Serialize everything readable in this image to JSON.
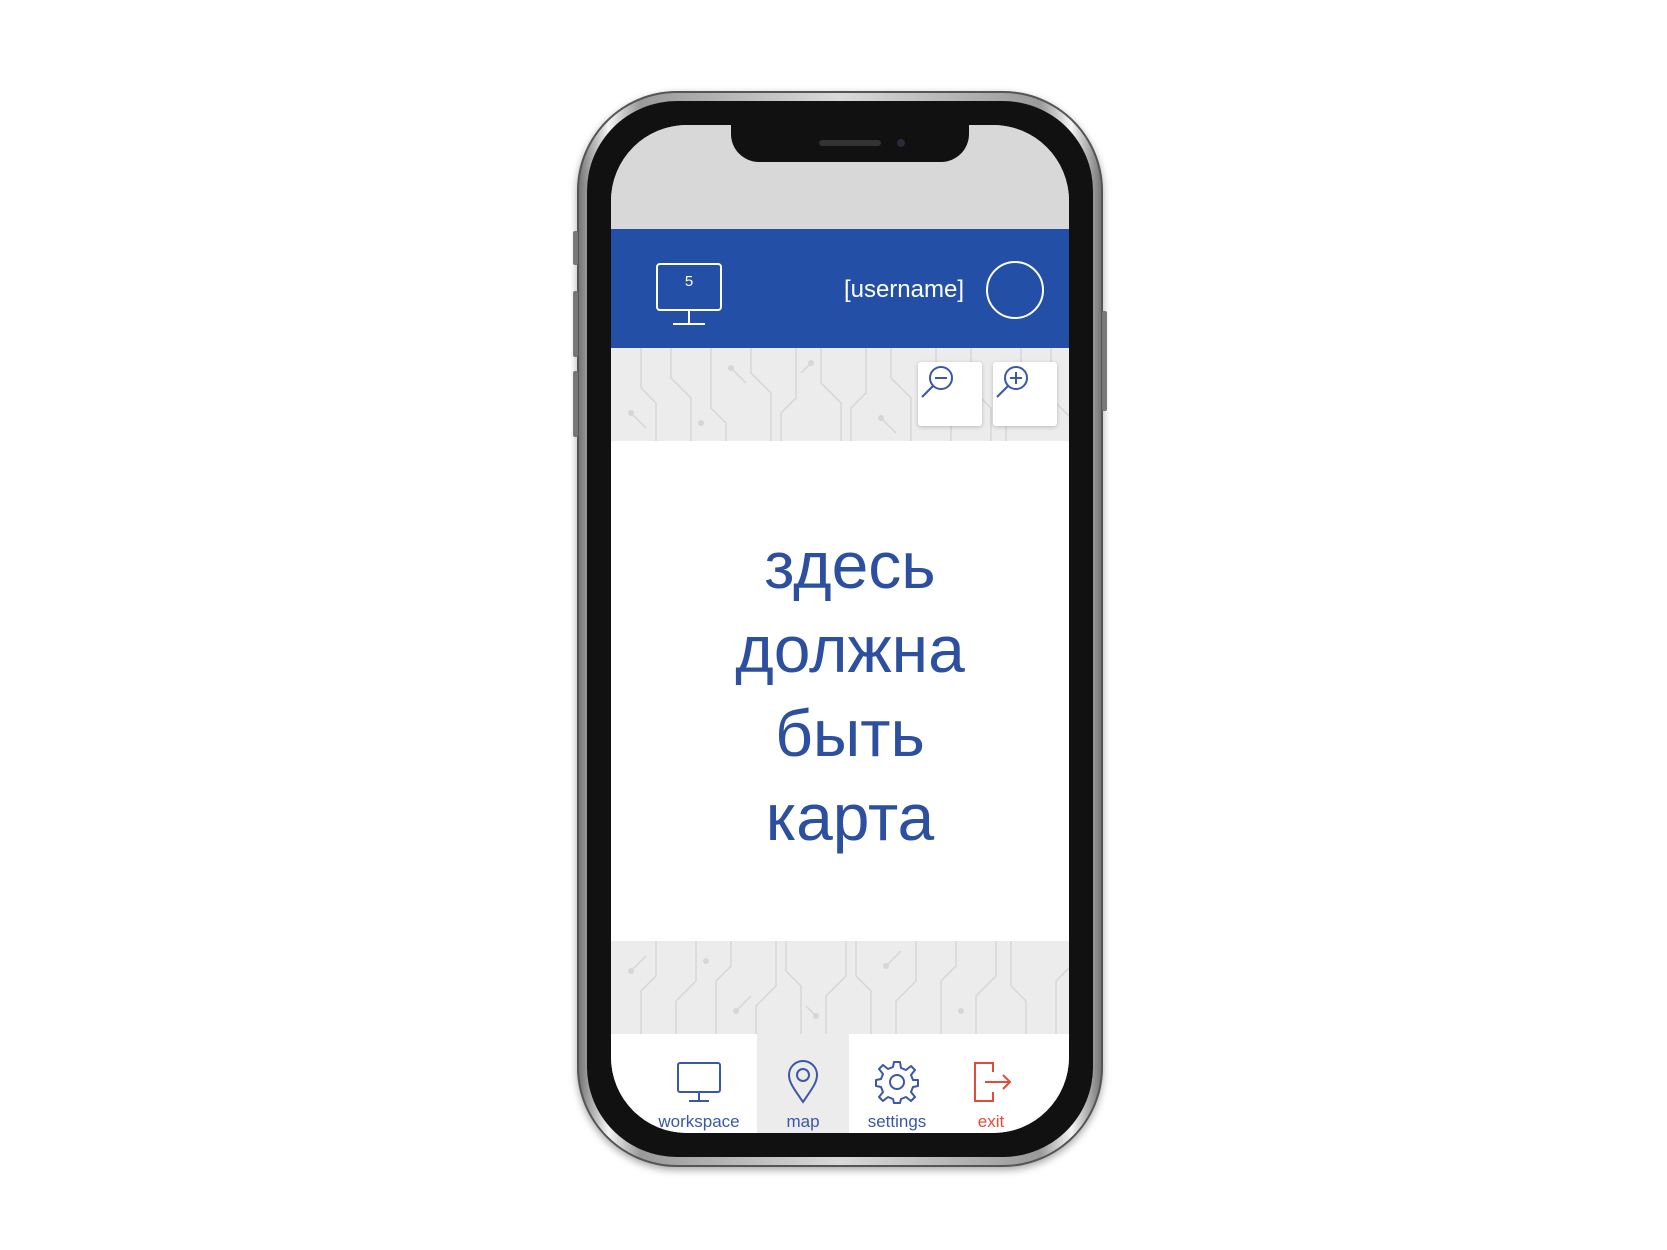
{
  "header": {
    "workspace_count": "5",
    "username": "[username]"
  },
  "map": {
    "placeholder_lines": [
      "здесь",
      "должна",
      "быть",
      "карта"
    ]
  },
  "zoom": {
    "out_icon": "zoom-out-icon",
    "in_icon": "zoom-in-icon"
  },
  "nav": {
    "items": [
      {
        "label": "workspace",
        "icon": "monitor-icon"
      },
      {
        "label": "map",
        "icon": "map-pin-icon",
        "active": true
      },
      {
        "label": "settings",
        "icon": "gear-icon"
      },
      {
        "label": "exit",
        "icon": "exit-icon"
      }
    ]
  },
  "colors": {
    "header_bg": "#2350a6",
    "accent_text": "#2d4fa0",
    "nav_text": "#3a57a8",
    "exit_red": "#e24a3a",
    "status_bar": "#d8d8d8",
    "band_bg": "#ececec"
  }
}
